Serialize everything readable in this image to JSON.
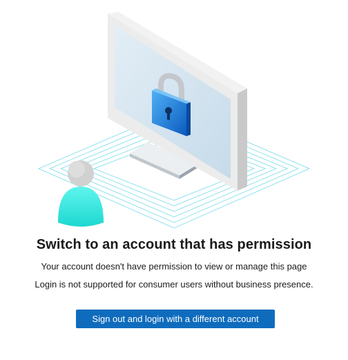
{
  "illustration": {
    "icon": "locked-monitor-with-user",
    "accent_color": "#1e88e5",
    "user_color": "#2ee8e0"
  },
  "title": "Switch to an account that has permission",
  "messages": [
    "Your account doesn't have permission to view or manage this page",
    "Login is not supported for consumer users without business presence."
  ],
  "action": {
    "label": "Sign out and login with a different account",
    "color": "#0f6cbd"
  }
}
